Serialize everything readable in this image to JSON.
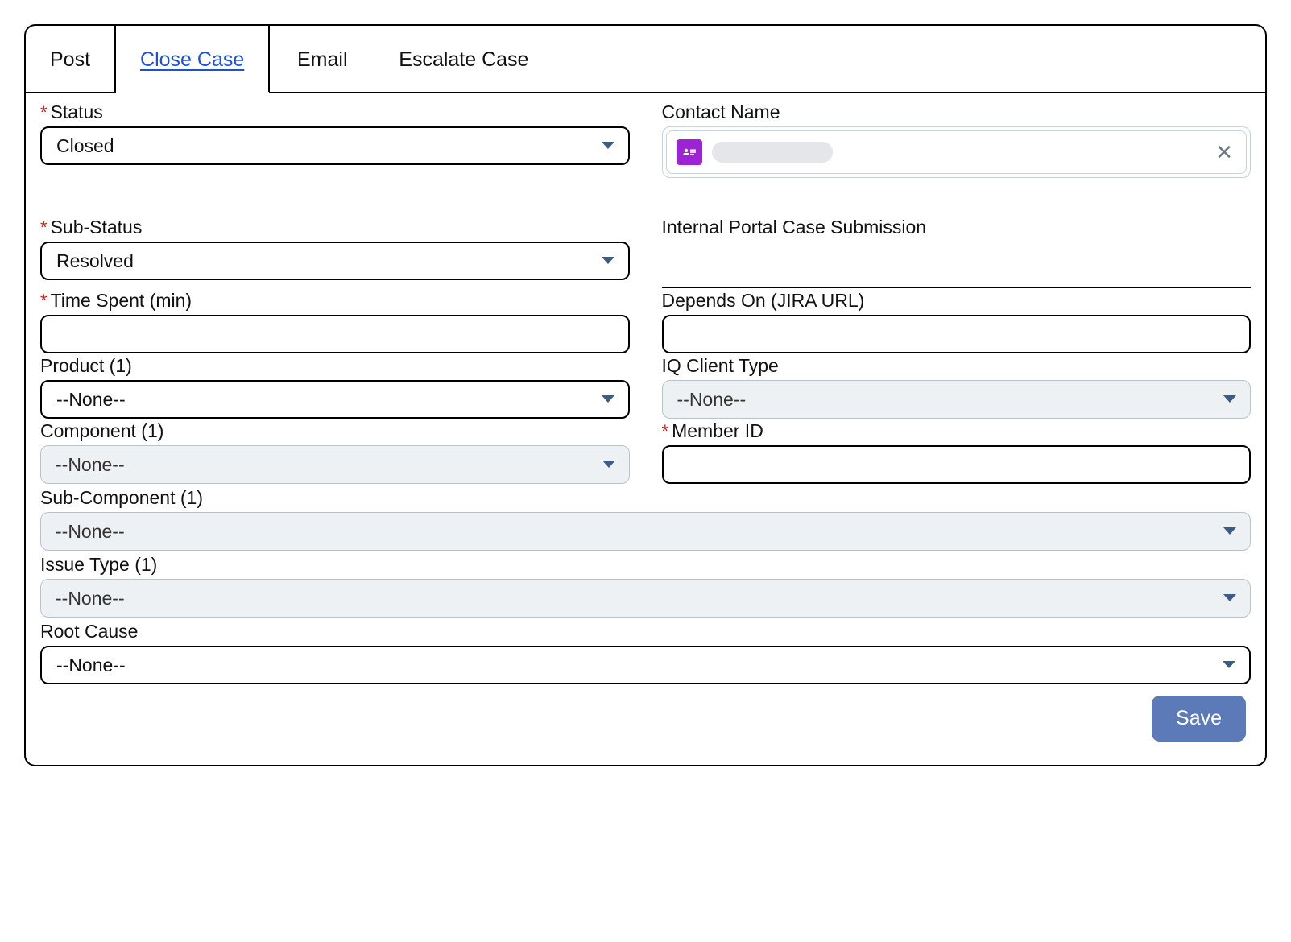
{
  "tabs": {
    "post": "Post",
    "close_case": "Close Case",
    "email": "Email",
    "escalate_case": "Escalate Case"
  },
  "labels": {
    "status": "Status",
    "sub_status": "Sub-Status",
    "time_spent": "Time Spent (min)",
    "product": "Product (1)",
    "component": "Component (1)",
    "sub_component": "Sub-Component (1)",
    "issue_type": "Issue Type (1)",
    "root_cause": "Root Cause",
    "contact_name": "Contact Name",
    "internal_portal": "Internal Portal Case Submission",
    "depends_on": "Depends On (JIRA URL)",
    "iq_client_type": "IQ Client Type",
    "member_id": "Member ID"
  },
  "values": {
    "status": "Closed",
    "sub_status": "Resolved",
    "time_spent": "",
    "product": "--None--",
    "component": "--None--",
    "sub_component": "--None--",
    "issue_type": "--None--",
    "root_cause": "--None--",
    "depends_on": "",
    "iq_client_type": "--None--",
    "member_id": "",
    "contact_name": ""
  },
  "buttons": {
    "save": "Save"
  },
  "required_marker": "*"
}
